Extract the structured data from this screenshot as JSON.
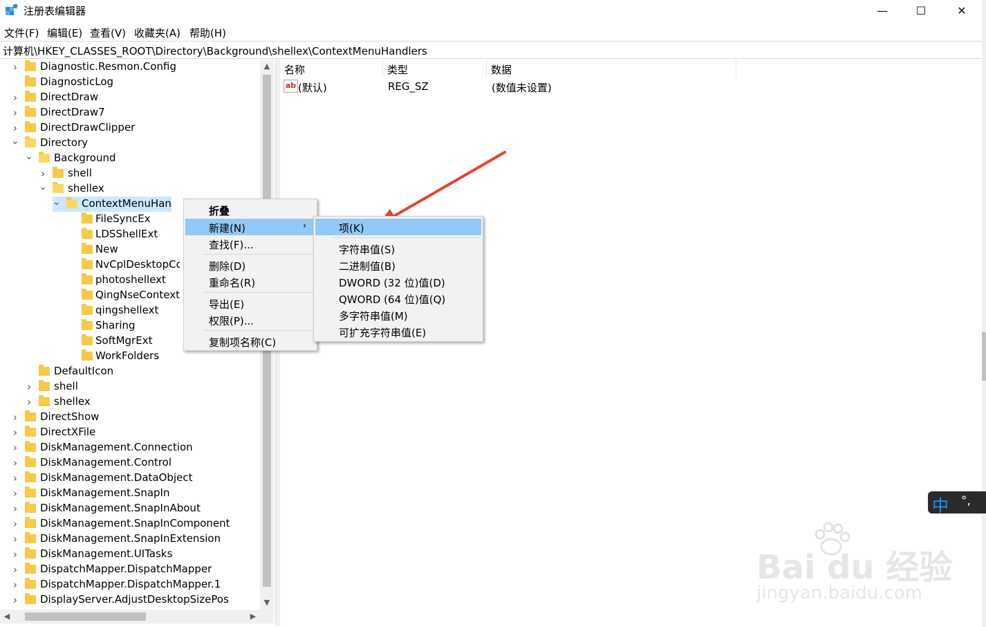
{
  "window": {
    "title": "注册表编辑器",
    "minimize": "—",
    "maximize": "☐",
    "close": "✕"
  },
  "menu": [
    "文件(F)",
    "编辑(E)",
    "查看(V)",
    "收藏夹(A)",
    "帮助(H)"
  ],
  "address": "计算机\\HKEY_CLASSES_ROOT\\Directory\\Background\\shellex\\ContextMenuHandlers",
  "tree": [
    {
      "label": "Diagnostic.Resmon.Config"
    },
    {
      "label": "DiagnosticLog"
    },
    {
      "label": "DirectDraw"
    },
    {
      "label": "DirectDraw7"
    },
    {
      "label": "DirectDrawClipper"
    },
    {
      "label": "Directory"
    },
    {
      "label": "Background"
    },
    {
      "label": "shell"
    },
    {
      "label": "shellex"
    },
    {
      "label": "ContextMenuHandlers"
    },
    {
      "label": "FileSyncEx"
    },
    {
      "label": "LDSShellExt"
    },
    {
      "label": "New"
    },
    {
      "label": "NvCplDesktopContext"
    },
    {
      "label": "photoshellext"
    },
    {
      "label": "QingNseContextMenu"
    },
    {
      "label": "qingshellext"
    },
    {
      "label": "Sharing"
    },
    {
      "label": "SoftMgrExt"
    },
    {
      "label": "WorkFolders"
    },
    {
      "label": "DefaultIcon"
    },
    {
      "label": "shell"
    },
    {
      "label": "shellex"
    },
    {
      "label": "DirectShow"
    },
    {
      "label": "DirectXFile"
    },
    {
      "label": "DiskManagement.Connection"
    },
    {
      "label": "DiskManagement.Control"
    },
    {
      "label": "DiskManagement.DataObject"
    },
    {
      "label": "DiskManagement.SnapIn"
    },
    {
      "label": "DiskManagement.SnapInAbout"
    },
    {
      "label": "DiskManagement.SnapInComponent"
    },
    {
      "label": "DiskManagement.SnapInExtension"
    },
    {
      "label": "DiskManagement.UITasks"
    },
    {
      "label": "DispatchMapper.DispatchMapper"
    },
    {
      "label": "DispatchMapper.DispatchMapper.1"
    },
    {
      "label": "DisplayServer.AdjustDesktopSizePos"
    }
  ],
  "columns": {
    "name": "名称",
    "type": "类型",
    "data": "数据"
  },
  "values": [
    {
      "name": "(默认)",
      "type": "REG_SZ",
      "data": "(数值未设置)",
      "icon": "ab"
    }
  ],
  "context_menu": {
    "collapse": "折叠",
    "new": "新建(N)",
    "find": "查找(F)...",
    "delete": "删除(D)",
    "rename": "重命名(R)",
    "export": "导出(E)",
    "permissions": "权限(P)...",
    "copy_name": "复制项名称(C)"
  },
  "submenu": {
    "key": "项(K)",
    "string": "字符串值(S)",
    "binary": "二进制值(B)",
    "dword": "DWORD (32 位)值(D)",
    "qword": "QWORD (64 位)值(Q)",
    "multi": "多字符串值(M)",
    "expand": "可扩充字符串值(E)"
  },
  "ime": {
    "lang": "中",
    "punct": "°,"
  },
  "watermark": {
    "brand": "Bai du 经验",
    "url": "jingyan.baidu.com"
  },
  "colors": {
    "highlight": "#91c9f7",
    "selection": "#cce8ff",
    "folder": "#f7c948",
    "arrow": "#e8412c"
  }
}
